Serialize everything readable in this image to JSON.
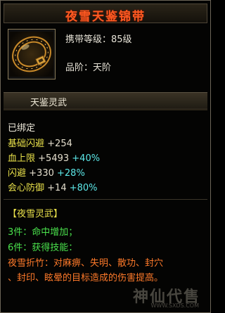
{
  "item": {
    "name": "夜雪天鉴锦带",
    "name_color": "#ff5a22",
    "carry_level_label": "携带等级：85级",
    "grade_label": "品阶：天阶",
    "icon": "belt-icon"
  },
  "tab": {
    "label": "天鉴灵武"
  },
  "status": "已绑定",
  "base_stat": {
    "name": "基础闪避",
    "value": "+254"
  },
  "attributes": [
    {
      "name": "血上限",
      "value": "+5493",
      "bonus": "+40%"
    },
    {
      "name": "闪避",
      "value": "+330",
      "bonus": "+28%"
    },
    {
      "name": "会心防御",
      "value": "+14",
      "bonus": "+80%"
    }
  ],
  "set": {
    "title": "【夜雪灵武】",
    "piece3": "3件：命中增加；",
    "piece6": "6件：获得技能：",
    "skill_line1": "夜雪折竹：对麻痹、失明、散功、封穴",
    "skill_line2": "、封印、眩晕的目标造成的伤害提高。"
  },
  "watermark": {
    "text": "神仙代售",
    "url": "WWW.SXDS.COM"
  },
  "colors": {
    "title": "#ff5a22",
    "yellow": "#e8e04a",
    "green": "#4ae24c",
    "cyan": "#5ce8e8",
    "orange": "#ff7a2a"
  }
}
